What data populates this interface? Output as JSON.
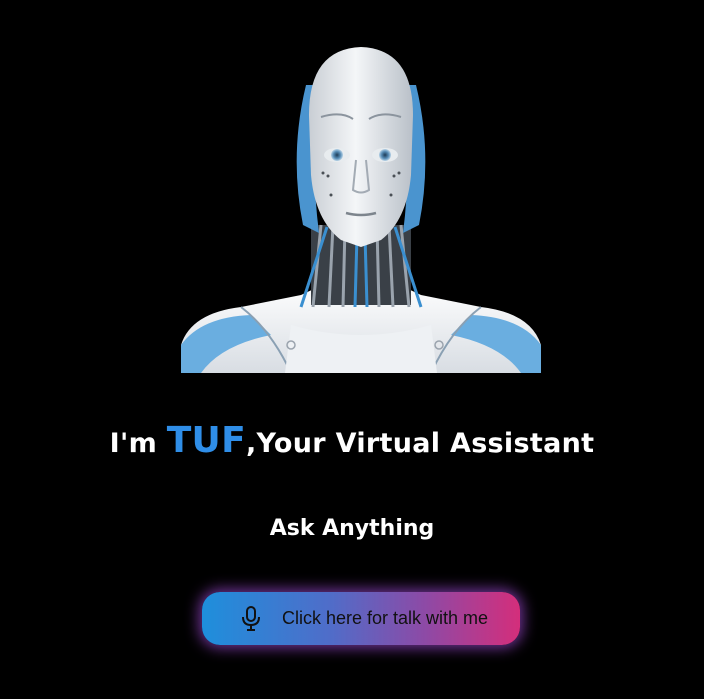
{
  "hero": {
    "image_alt": "humanoid robot",
    "greeting_prefix": "I'm ",
    "assistant_name": "TUF",
    "greeting_suffix": ",Your Virtual Assistant",
    "name_color": "#2f8ee8"
  },
  "prompt": {
    "text": "Ask Anything"
  },
  "talk_button": {
    "label": "Click here for talk with me",
    "icon": "microphone-icon",
    "gradient": [
      "#1e8fdc",
      "#d42e7b"
    ]
  }
}
